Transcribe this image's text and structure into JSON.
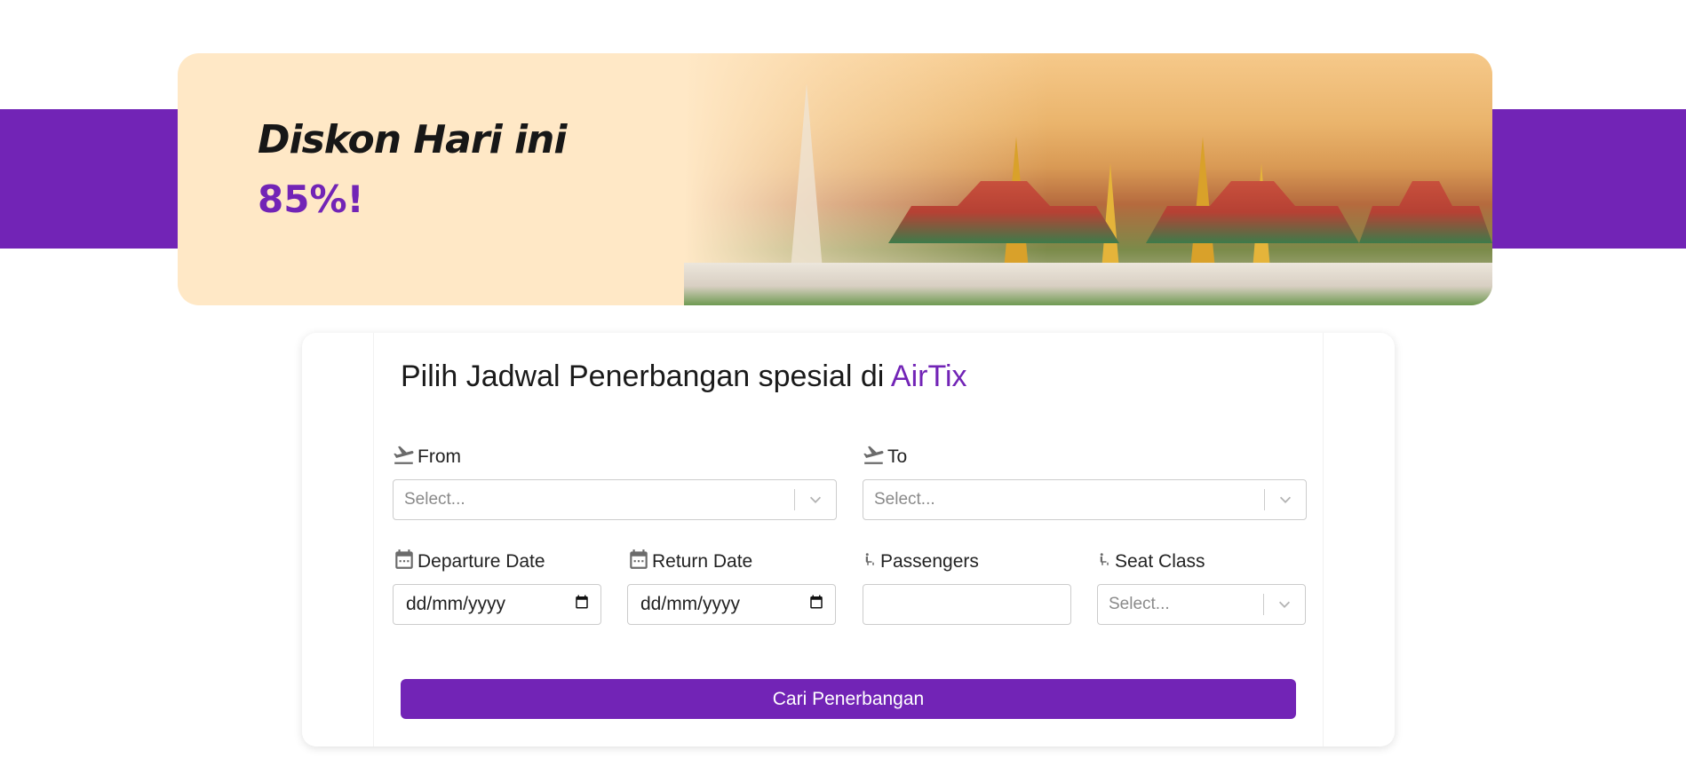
{
  "hero": {
    "title": "Diskon Hari ini",
    "discount": "85%!",
    "image": "grand-palace-bangkok"
  },
  "form": {
    "title_prefix": "Pilih Jadwal Penerbangan spesial di ",
    "title_brand": "AirTix",
    "from": {
      "label": "From",
      "placeholder": "Select...",
      "icon": "plane-departure-icon"
    },
    "to": {
      "label": "To",
      "placeholder": "Select...",
      "icon": "plane-departure-icon"
    },
    "departure_date": {
      "label": "Departure Date",
      "placeholder": "dd/mm/yyyy",
      "icon": "calendar-icon"
    },
    "return_date": {
      "label": "Return Date",
      "placeholder": "dd/mm/yyyy",
      "icon": "calendar-icon"
    },
    "passengers": {
      "label": "Passengers",
      "value": "",
      "icon": "seat-icon"
    },
    "seat_class": {
      "label": "Seat Class",
      "placeholder": "Select...",
      "icon": "seat-icon"
    },
    "submit_label": "Cari Penerbangan"
  },
  "colors": {
    "brand": "#7224b6",
    "hero_bg": "#ffe8c6"
  }
}
